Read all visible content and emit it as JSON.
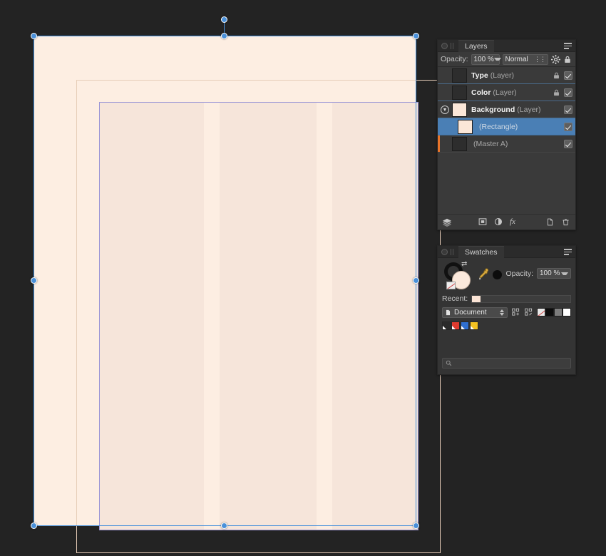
{
  "app": {
    "canvas_background": "#232323",
    "page_color": "#fdeee2",
    "frame_color": "#f6e5da",
    "frame_stroke": "#9a95d6",
    "margin_guide_color": "#e7cdb8",
    "selection_color": "#4a90d9",
    "accent_orange": "#e8742a",
    "selected_row_color": "#4a7fb5"
  },
  "document": {
    "name": "document-canvas",
    "selection_handles": 8,
    "rotation_handle": "rotation-handle",
    "columns": 3,
    "gutters": 2
  },
  "layers_panel": {
    "tab_label": "Layers",
    "menu_icon": "panel-menu-icon",
    "dock_icon": "panel-dock-icon",
    "opacity_label": "Opacity:",
    "opacity_value": "100 %",
    "blend_mode": "Normal",
    "blend_options_icon": "blend-options-icon",
    "settings_icon": "gear-icon",
    "lock_icon": "lock-icon",
    "rows": [
      {
        "name": "Type",
        "kind": "(Layer)",
        "thumb": "dark",
        "locked": true,
        "visible": true,
        "selected": false,
        "expander": false,
        "master_bar": false
      },
      {
        "name": "Color",
        "kind": "(Layer)",
        "thumb": "dark",
        "locked": true,
        "visible": true,
        "selected": false,
        "expander": false,
        "master_bar": false
      },
      {
        "name": "Background",
        "kind": "(Layer)",
        "thumb": "cream",
        "locked": false,
        "visible": true,
        "selected": false,
        "expander": true,
        "master_bar": false
      },
      {
        "name": "",
        "kind": "(Rectangle)",
        "thumb": "cream",
        "locked": false,
        "visible": true,
        "selected": true,
        "expander": false,
        "master_bar": false
      },
      {
        "name": "",
        "kind": "(Master A)",
        "thumb": "dark",
        "locked": false,
        "visible": true,
        "selected": false,
        "expander": false,
        "master_bar": true
      }
    ],
    "footer": {
      "layers_icon": "stack-layers-icon",
      "mask_icon": "mask-icon",
      "adjustment_icon": "adjustment-icon",
      "fx_icon": "fx-icon",
      "new_layer_icon": "new-layer-icon",
      "delete_icon": "trash-icon"
    }
  },
  "swatches_panel": {
    "tab_label": "Swatches",
    "menu_icon": "panel-menu-icon",
    "dock_icon": "panel-dock-icon",
    "stroke_swatch_color": "#111111",
    "fill_swatch_color": "#fbe9dc",
    "none_swatch_icon": "no-color-icon",
    "swap_icon": "swap-fill-stroke-icon",
    "eyedropper_icon": "eyedropper-icon",
    "black_dot_color": "#0c0c0c",
    "opacity_label": "Opacity:",
    "opacity_value": "100 %",
    "recent_label": "Recent:",
    "recent_colors": [
      "#fbe4d5"
    ],
    "palette_select": "Document",
    "palette_icon": "document-icon",
    "add_swatch_icon": "add-swatch-icon",
    "edit_swatch_icon": "edit-swatch-icon",
    "quick_chips": [
      {
        "name": "none-chip",
        "color": "none"
      },
      {
        "name": "black-chip",
        "color": "#0c0c0c"
      },
      {
        "name": "gray-chip",
        "color": "#7c7c7c"
      },
      {
        "name": "white-chip",
        "color": "#ffffff"
      }
    ],
    "palette_swatches": [
      {
        "name": "swatch-black",
        "color": "#2a2a2a"
      },
      {
        "name": "swatch-red",
        "color": "#e03b2f"
      },
      {
        "name": "swatch-blue",
        "color": "#2f6fd0"
      },
      {
        "name": "swatch-yellow",
        "color": "#f3c222"
      }
    ],
    "search_placeholder": "",
    "search_value": "",
    "search_icon": "search-icon"
  }
}
